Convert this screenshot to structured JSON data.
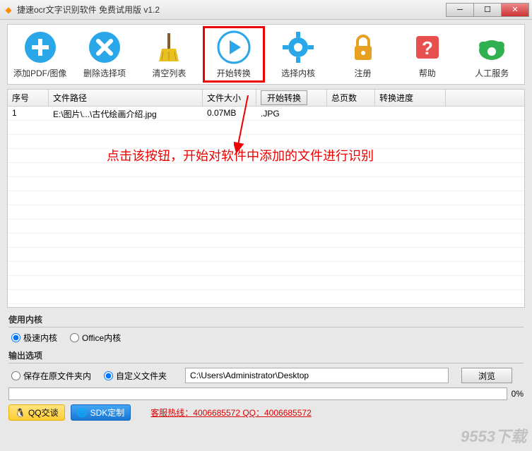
{
  "window": {
    "title": "捷速ocr文字识别软件 免费试用版 v1.2"
  },
  "toolbar": {
    "items": [
      {
        "label": "添加PDF/图像",
        "icon": "plus",
        "color": "#29a7e8"
      },
      {
        "label": "删除选择项",
        "icon": "x",
        "color": "#29a7e8"
      },
      {
        "label": "清空列表",
        "icon": "broom",
        "color": "#e8c020"
      },
      {
        "label": "开始转换",
        "icon": "play",
        "color": "#29a7e8",
        "highlight": true
      },
      {
        "label": "选择内核",
        "icon": "gear",
        "color": "#29a7e8"
      },
      {
        "label": "注册",
        "icon": "lock",
        "color": "#e8a020"
      },
      {
        "label": "帮助",
        "icon": "help",
        "color": "#e85050"
      },
      {
        "label": "人工服务",
        "icon": "phone",
        "color": "#30b050"
      }
    ]
  },
  "table": {
    "headers": [
      "序号",
      "文件路径",
      "文件大小",
      "开始转换",
      "总页数",
      "转换进度"
    ],
    "action_label": "开始转换",
    "rows": [
      {
        "seq": "1",
        "path": "E:\\图片\\...\\古代绘画介绍.jpg",
        "size": "0.07MB",
        "type": ".JPG",
        "pages": "",
        "progress": ""
      }
    ]
  },
  "annotation": {
    "text": "点击该按钮，开始对软件中添加的文件进行识别"
  },
  "kernel": {
    "section": "使用内核",
    "options": [
      "极速内核",
      "Office内核"
    ],
    "selected": 0
  },
  "output": {
    "section": "输出选项",
    "options": [
      "保存在原文件夹内",
      "自定义文件夹"
    ],
    "selected": 1,
    "path": "C:\\Users\\Administrator\\Desktop",
    "browse": "浏览"
  },
  "progress": {
    "value": "0%"
  },
  "footer": {
    "qq": "QQ交谈",
    "sdk": "SDK定制",
    "hotline": "客服热线：4006685572 QQ：4006685572",
    "watermark": "9553下载"
  }
}
